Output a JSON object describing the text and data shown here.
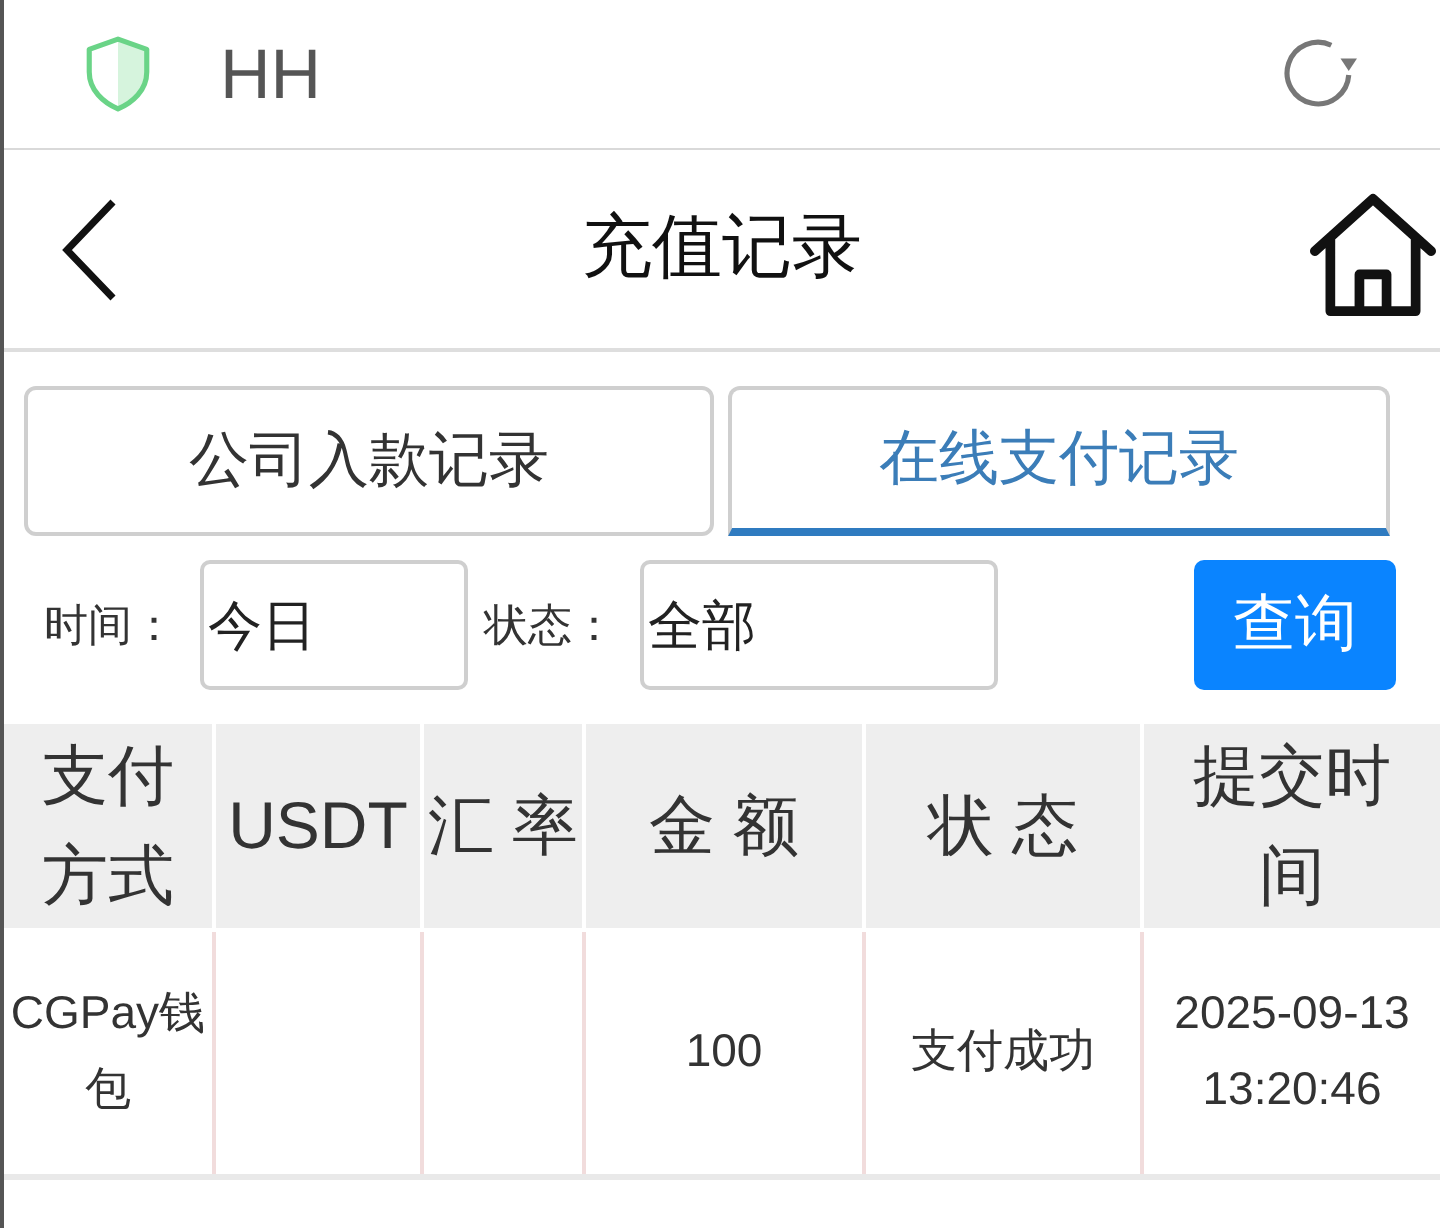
{
  "top_bar": {
    "title": "HH"
  },
  "header": {
    "title": "充值记录"
  },
  "tabs": [
    {
      "label": "公司入款记录",
      "selected": false
    },
    {
      "label": "在线支付记录",
      "selected": true
    }
  ],
  "filters": [
    {
      "label": "时间：",
      "value": "今日"
    },
    {
      "label": "状态：",
      "value": "全部"
    }
  ],
  "search_button": {
    "label": "查询"
  },
  "table": {
    "columns": [
      "支付方式",
      "USDT",
      "汇 率",
      "金 额",
      "状 态",
      "提交时间"
    ],
    "rows": [
      {
        "cells": [
          "CGPay钱包",
          null,
          null,
          "100",
          "支付成功",
          "2025-09-13 13:20:46"
        ]
      }
    ]
  }
}
